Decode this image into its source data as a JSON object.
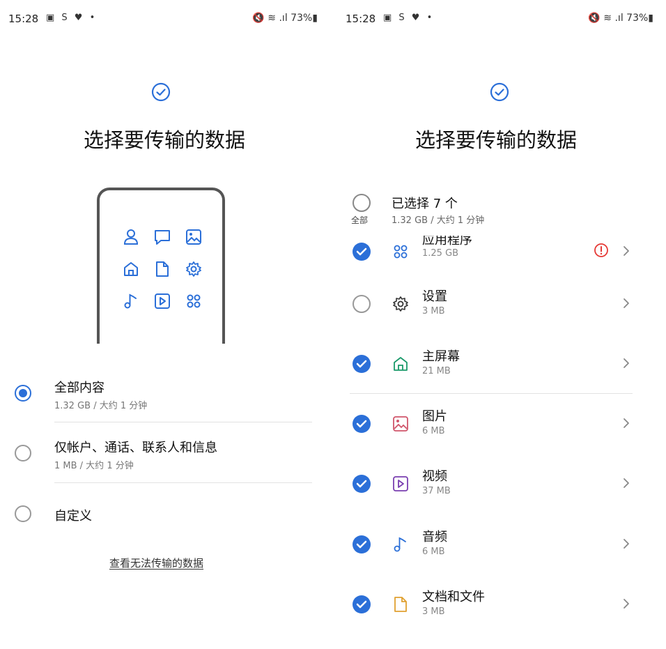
{
  "left": {
    "status": {
      "time": "15:28",
      "icons": "▣ S ♥ •",
      "right": "🔇 ≋ .ıl 73%▮"
    },
    "title": "选择要传输的数据",
    "options": [
      {
        "label": "全部内容",
        "sub": "1.32 GB / 大约 1 分钟",
        "selected": true
      },
      {
        "label": "仅帐户、通话、联系人和信息",
        "sub": "1 MB / 大约 1 分钟",
        "selected": false
      },
      {
        "label": "自定义",
        "sub": "",
        "selected": false
      }
    ],
    "link": "查看无法传输的数据"
  },
  "right": {
    "status": {
      "time": "15:28",
      "icons": "▣ S ♥ •",
      "right": "🔇 ≋ .ıl 73%▮"
    },
    "title": "选择要传输的数据",
    "all_label": "全部",
    "selected_title": "已选择 7 个",
    "selected_sub": "1.32 GB / 大约 1 分钟",
    "items": [
      {
        "label": "应用程序",
        "size": "1.25 GB",
        "checked": true,
        "icon": "apps-icon",
        "warning": true
      },
      {
        "label": "设置",
        "size": "3 MB",
        "checked": false,
        "icon": "gear-icon",
        "warning": false
      },
      {
        "label": "主屏幕",
        "size": "21 MB",
        "checked": true,
        "icon": "home-icon",
        "warning": false
      },
      {
        "label": "图片",
        "size": "6 MB",
        "checked": true,
        "icon": "image-icon",
        "warning": false
      },
      {
        "label": "视频",
        "size": "37 MB",
        "checked": true,
        "icon": "video-icon",
        "warning": false
      },
      {
        "label": "音频",
        "size": "6 MB",
        "checked": true,
        "icon": "music-icon",
        "warning": false
      },
      {
        "label": "文档和文件",
        "size": "3 MB",
        "checked": true,
        "icon": "document-icon",
        "warning": false
      }
    ],
    "colors": {
      "accent": "#2b6fd8",
      "warning": "#e53935"
    }
  }
}
